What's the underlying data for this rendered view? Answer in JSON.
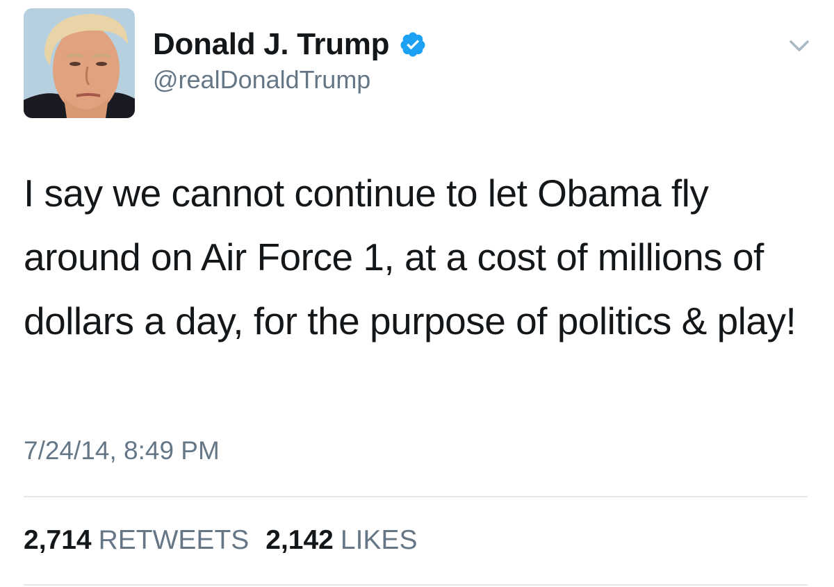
{
  "author": {
    "name": "Donald J. Trump",
    "handle": "@realDonaldTrump",
    "verified": true,
    "verified_color": "#1da1f2"
  },
  "tweet": {
    "text": "I say we cannot continue to let Obama fly around on Air Force 1, at a cost of millions of dollars a day, for the purpose of politics & play!",
    "timestamp": "7/24/14, 8:49 PM"
  },
  "stats": {
    "retweets_count": "2,714",
    "retweets_label": "RETWEETS",
    "likes_count": "2,142",
    "likes_label": "LIKES"
  },
  "icons": {
    "verified": "verified-badge-icon",
    "menu": "chevron-down-icon"
  },
  "colors": {
    "text": "#14171a",
    "secondary": "#657786",
    "divider": "#e1e8ed"
  }
}
